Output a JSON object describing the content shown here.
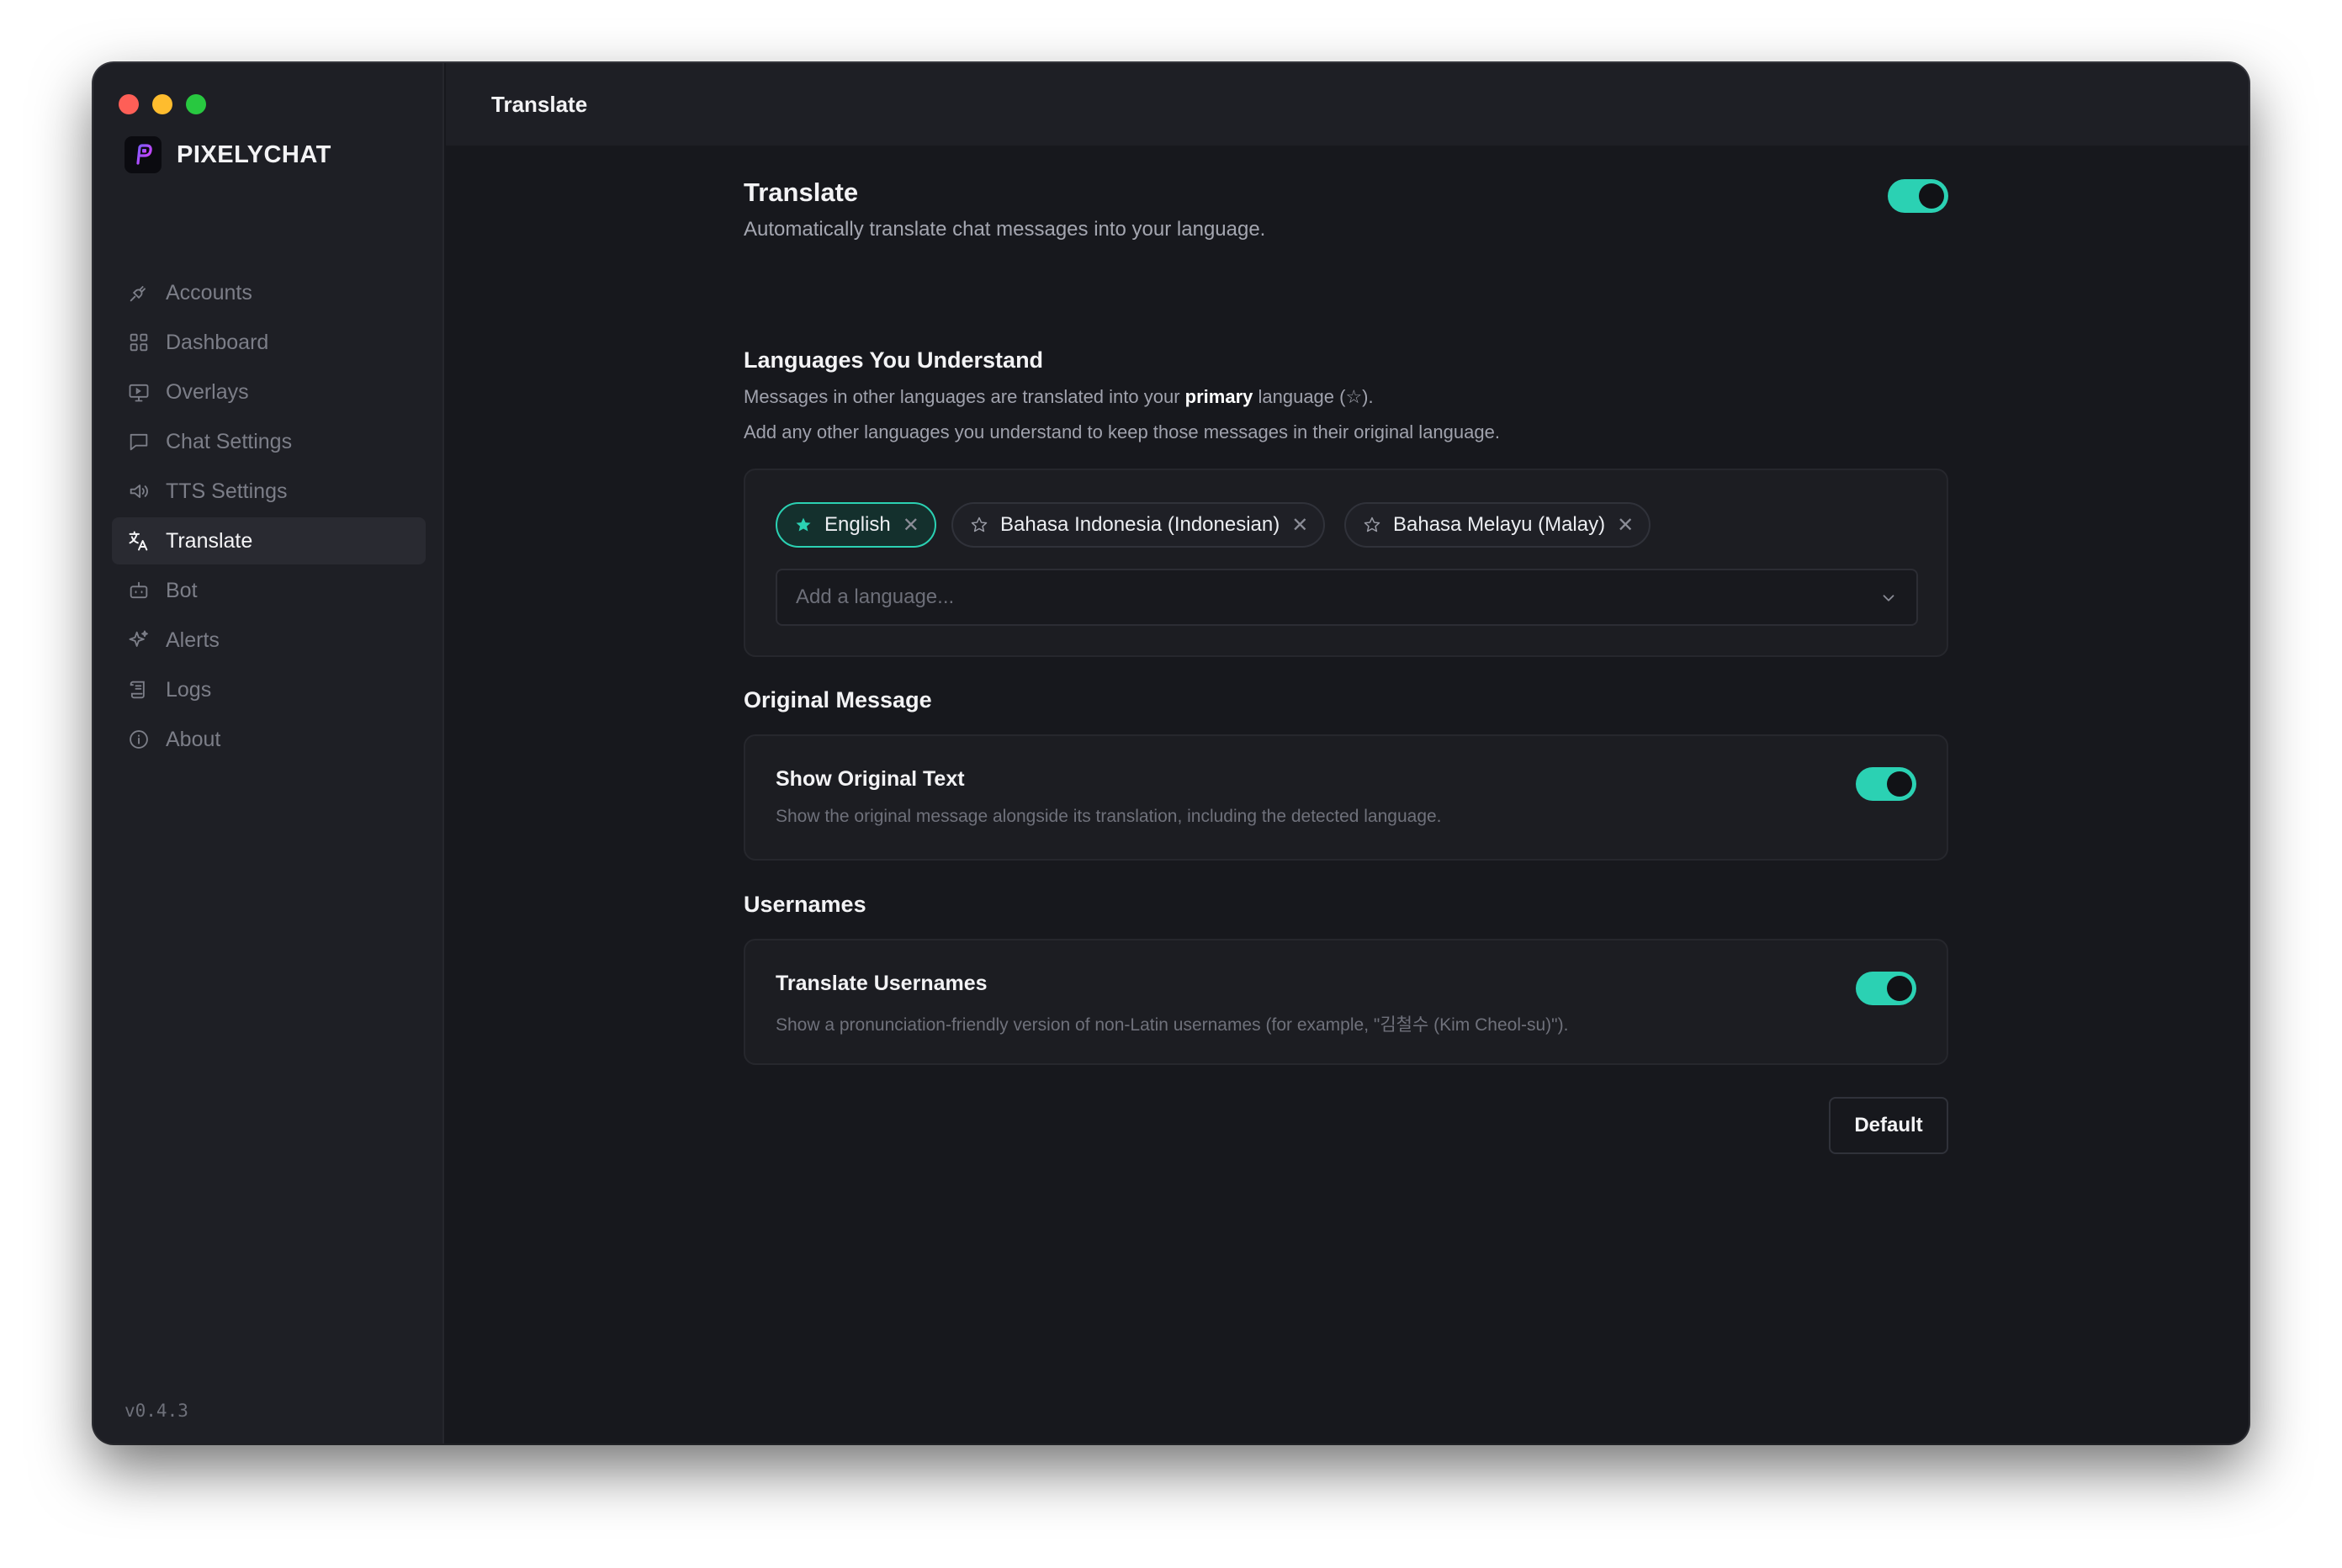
{
  "app": {
    "name": "PIXELYCHAT",
    "version": "v0.4.3"
  },
  "sidebar": {
    "items": [
      {
        "label": "Accounts",
        "icon": "plug-icon"
      },
      {
        "label": "Dashboard",
        "icon": "grid-icon"
      },
      {
        "label": "Overlays",
        "icon": "monitor-icon"
      },
      {
        "label": "Chat Settings",
        "icon": "chat-icon"
      },
      {
        "label": "TTS Settings",
        "icon": "speaker-icon"
      },
      {
        "label": "Translate",
        "icon": "translate-icon",
        "active": true
      },
      {
        "label": "Bot",
        "icon": "bot-icon"
      },
      {
        "label": "Alerts",
        "icon": "sparkles-icon"
      },
      {
        "label": "Logs",
        "icon": "scroll-icon"
      },
      {
        "label": "About",
        "icon": "info-icon"
      }
    ]
  },
  "header": {
    "title": "Translate"
  },
  "translate": {
    "title": "Translate",
    "description": "Automatically translate chat messages into your language.",
    "enabled": true
  },
  "languages": {
    "heading": "Languages You Understand",
    "desc_line1_pre": "Messages in other languages are translated into your ",
    "desc_line1_bold": "primary",
    "desc_line1_post": " language (☆).",
    "desc_line2": "Add any other languages you understand to keep those messages in their original language.",
    "chips": [
      {
        "label": "English",
        "primary": true
      },
      {
        "label": "Bahasa Indonesia (Indonesian)",
        "primary": false
      },
      {
        "label": "Bahasa Melayu (Malay)",
        "primary": false
      }
    ],
    "add_placeholder": "Add a language..."
  },
  "original_message": {
    "heading": "Original Message",
    "setting_title": "Show Original Text",
    "setting_desc": "Show the original message alongside its translation, including the detected language.",
    "enabled": true
  },
  "usernames": {
    "heading": "Usernames",
    "setting_title": "Translate Usernames",
    "setting_desc": "Show a pronunciation-friendly version of non-Latin usernames (for example, \"김철수 (Kim Cheol-su)\").",
    "enabled": true
  },
  "actions": {
    "default_label": "Default"
  },
  "colors": {
    "accent": "#2bd1b3",
    "background": "#17181d",
    "sidebar": "#1e1f25",
    "brand": "#b44bff"
  }
}
